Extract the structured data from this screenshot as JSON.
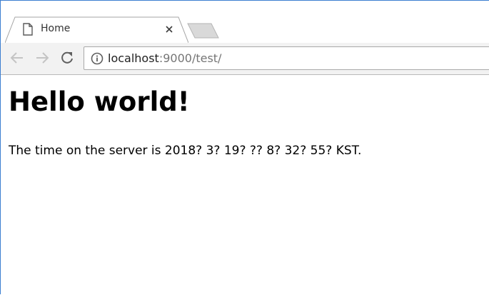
{
  "browser": {
    "tab": {
      "title": "Home",
      "favicon": "page-icon",
      "close": "close-icon"
    },
    "toolbar": {
      "back": "back-arrow-icon",
      "forward": "forward-arrow-icon",
      "reload": "reload-icon"
    },
    "address": {
      "security_icon": "info-icon",
      "host": "localhost",
      "rest": ":9000/test/"
    }
  },
  "page": {
    "heading": "Hello world!",
    "time_text": "The time on the server is 2018? 3? 19? ?? 8? 32? 55? KST."
  },
  "colors": {
    "window_border": "#3c7fd0",
    "toolbar_bg": "#f2f2f2",
    "tab_bg": "#ffffff",
    "url_host": "#222222",
    "url_rest": "#757575"
  }
}
